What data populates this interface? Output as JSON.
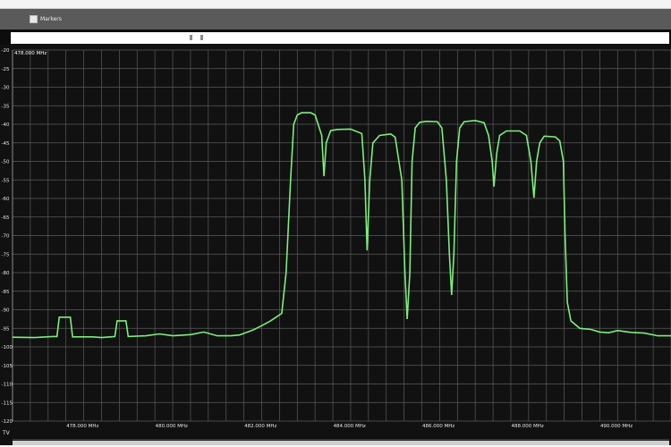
{
  "toolbar": {
    "markers_label": "Markers"
  },
  "plot": {
    "marker_readout": "478.000 MHz",
    "bottom_label": "TV",
    "colors": {
      "trace": "#7bef7b",
      "grid": "#5b5b5b",
      "background": "#111111"
    }
  },
  "chart_data": {
    "type": "line",
    "title": "",
    "xlabel": "",
    "ylabel": "",
    "xlim": [
      476.0,
      490.8
    ],
    "ylim": [
      -120,
      -20
    ],
    "grid": true,
    "y_ticks": [
      -20,
      -25,
      -30,
      -35,
      -40,
      -45,
      -50,
      -55,
      -60,
      -65,
      -70,
      -75,
      -80,
      -85,
      -90,
      -95,
      -100,
      -105,
      -110,
      -115,
      -120
    ],
    "y_tick_labels": [
      "-20",
      "-25",
      "-30",
      "-35",
      "-40",
      "-45",
      "-50",
      "-55",
      "-60",
      "-65",
      "-70",
      "-75",
      "-80",
      "-85",
      "-90",
      "-95",
      "-100",
      "-105",
      "-110",
      "-115",
      "-120"
    ],
    "x_ticks": [
      478.0,
      480.0,
      482.0,
      484.0,
      486.0,
      488.0,
      490.0
    ],
    "x_tick_labels": [
      "478.000 MHz",
      "480.000 MHz",
      "482.000 MHz",
      "484.000 MHz",
      "486.000 MHz",
      "488.000 MHz",
      "490.000 MHz"
    ],
    "series": [
      {
        "points": [
          [
            476.0,
            -97.4
          ],
          [
            476.5,
            -97.5
          ],
          [
            476.9,
            -97.2
          ],
          [
            477.0,
            -97.2
          ],
          [
            477.05,
            -92.0
          ],
          [
            477.3,
            -92.0
          ],
          [
            477.35,
            -97.3
          ],
          [
            477.8,
            -97.3
          ],
          [
            478.0,
            -97.5
          ],
          [
            478.2,
            -97.3
          ],
          [
            478.3,
            -97.2
          ],
          [
            478.35,
            -93.0
          ],
          [
            478.55,
            -93.0
          ],
          [
            478.6,
            -97.2
          ],
          [
            479.0,
            -97.0
          ],
          [
            479.3,
            -96.5
          ],
          [
            479.6,
            -97.0
          ],
          [
            480.0,
            -96.7
          ],
          [
            480.3,
            -96.0
          ],
          [
            480.6,
            -97.0
          ],
          [
            480.9,
            -97.0
          ],
          [
            481.1,
            -96.8
          ],
          [
            481.4,
            -95.5
          ],
          [
            481.6,
            -94.3
          ],
          [
            481.8,
            -93.0
          ],
          [
            482.05,
            -91.0
          ],
          [
            482.15,
            -80.0
          ],
          [
            482.25,
            -55.0
          ],
          [
            482.32,
            -40.0
          ],
          [
            482.4,
            -37.5
          ],
          [
            482.5,
            -36.9
          ],
          [
            482.7,
            -36.9
          ],
          [
            482.8,
            -37.5
          ],
          [
            482.95,
            -43.0
          ],
          [
            483.0,
            -54.0
          ],
          [
            483.05,
            -45.0
          ],
          [
            483.15,
            -41.7
          ],
          [
            483.3,
            -41.4
          ],
          [
            483.6,
            -41.3
          ],
          [
            483.85,
            -42.5
          ],
          [
            483.92,
            -55.0
          ],
          [
            483.97,
            -74.0
          ],
          [
            484.03,
            -55.0
          ],
          [
            484.1,
            -45.0
          ],
          [
            484.25,
            -43.0
          ],
          [
            484.5,
            -42.6
          ],
          [
            484.6,
            -43.5
          ],
          [
            484.75,
            -55.0
          ],
          [
            484.82,
            -80.0
          ],
          [
            484.87,
            -92.5
          ],
          [
            484.93,
            -80.0
          ],
          [
            484.98,
            -50.0
          ],
          [
            485.05,
            -41.0
          ],
          [
            485.15,
            -39.5
          ],
          [
            485.3,
            -39.2
          ],
          [
            485.55,
            -39.3
          ],
          [
            485.65,
            -41.0
          ],
          [
            485.75,
            -55.0
          ],
          [
            485.82,
            -75.0
          ],
          [
            485.87,
            -86.0
          ],
          [
            485.92,
            -75.0
          ],
          [
            485.98,
            -50.0
          ],
          [
            486.05,
            -41.0
          ],
          [
            486.15,
            -39.3
          ],
          [
            486.4,
            -39.0
          ],
          [
            486.6,
            -39.6
          ],
          [
            486.7,
            -43.0
          ],
          [
            486.78,
            -50.0
          ],
          [
            486.82,
            -56.8
          ],
          [
            486.88,
            -48.0
          ],
          [
            486.95,
            -43.0
          ],
          [
            487.1,
            -41.8
          ],
          [
            487.4,
            -41.8
          ],
          [
            487.55,
            -43.0
          ],
          [
            487.65,
            -50.0
          ],
          [
            487.72,
            -59.8
          ],
          [
            487.78,
            -50.0
          ],
          [
            487.85,
            -45.0
          ],
          [
            487.95,
            -43.2
          ],
          [
            488.2,
            -43.4
          ],
          [
            488.3,
            -44.5
          ],
          [
            488.38,
            -50.0
          ],
          [
            488.42,
            -70.0
          ],
          [
            488.47,
            -88.0
          ],
          [
            488.55,
            -93.0
          ],
          [
            488.75,
            -95.0
          ],
          [
            489.0,
            -95.3
          ],
          [
            489.2,
            -96.0
          ],
          [
            489.4,
            -96.2
          ],
          [
            489.6,
            -95.6
          ],
          [
            489.9,
            -96.1
          ],
          [
            490.2,
            -96.3
          ],
          [
            490.5,
            -97.0
          ],
          [
            490.8,
            -97.0
          ]
        ]
      }
    ]
  }
}
